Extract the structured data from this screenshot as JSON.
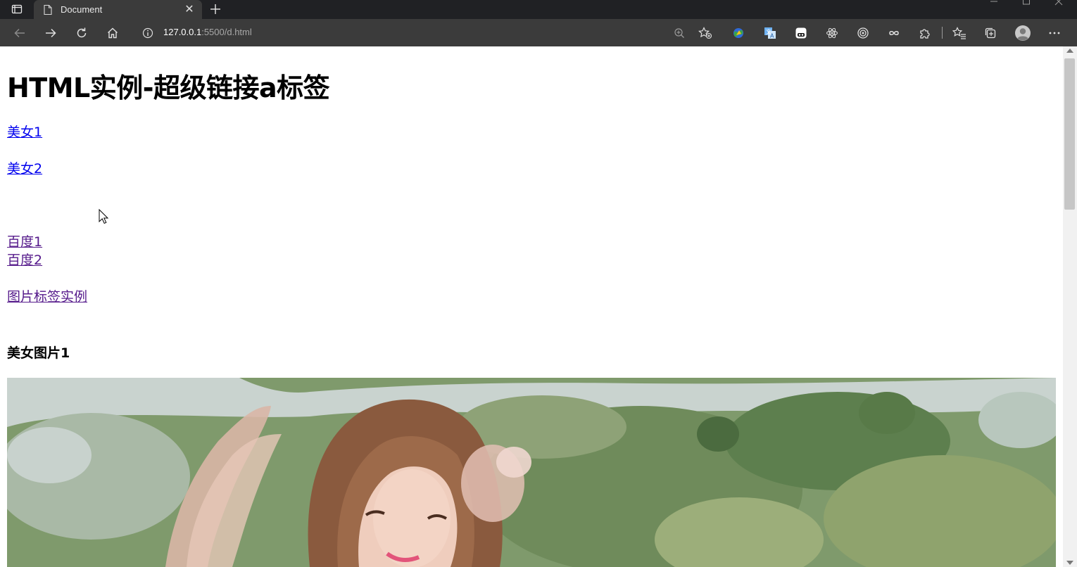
{
  "browser": {
    "tab_title": "Document",
    "url_host": "127.0.0.1",
    "url_path": ":5500/d.html"
  },
  "page": {
    "heading": "HTML实例-超级链接a标签",
    "links": [
      {
        "label": "美女1",
        "visited": false
      },
      {
        "label": "美女2",
        "visited": false
      },
      {
        "label": "百度1",
        "visited": true
      },
      {
        "label": "百度2",
        "visited": true
      },
      {
        "label": "图片标签实例",
        "visited": true
      }
    ],
    "image_section_heading": "美女图片1"
  },
  "colors": {
    "link": "#0000ee",
    "visited_link": "#551a8b",
    "chrome_dark": "#202124",
    "toolbar": "#3b3b3b"
  },
  "toolbar_icons": [
    "back-icon",
    "forward-icon",
    "refresh-icon",
    "home-icon",
    "info-icon",
    "zoom-icon",
    "add-favorite-icon",
    "extension-globe-icon",
    "translate-icon",
    "extension-face-icon",
    "react-devtools-icon",
    "extension-target-icon",
    "extension-infinity-icon",
    "extensions-puzzle-icon",
    "favorites-icon",
    "collections-icon",
    "profile-avatar-icon",
    "more-menu-icon"
  ]
}
